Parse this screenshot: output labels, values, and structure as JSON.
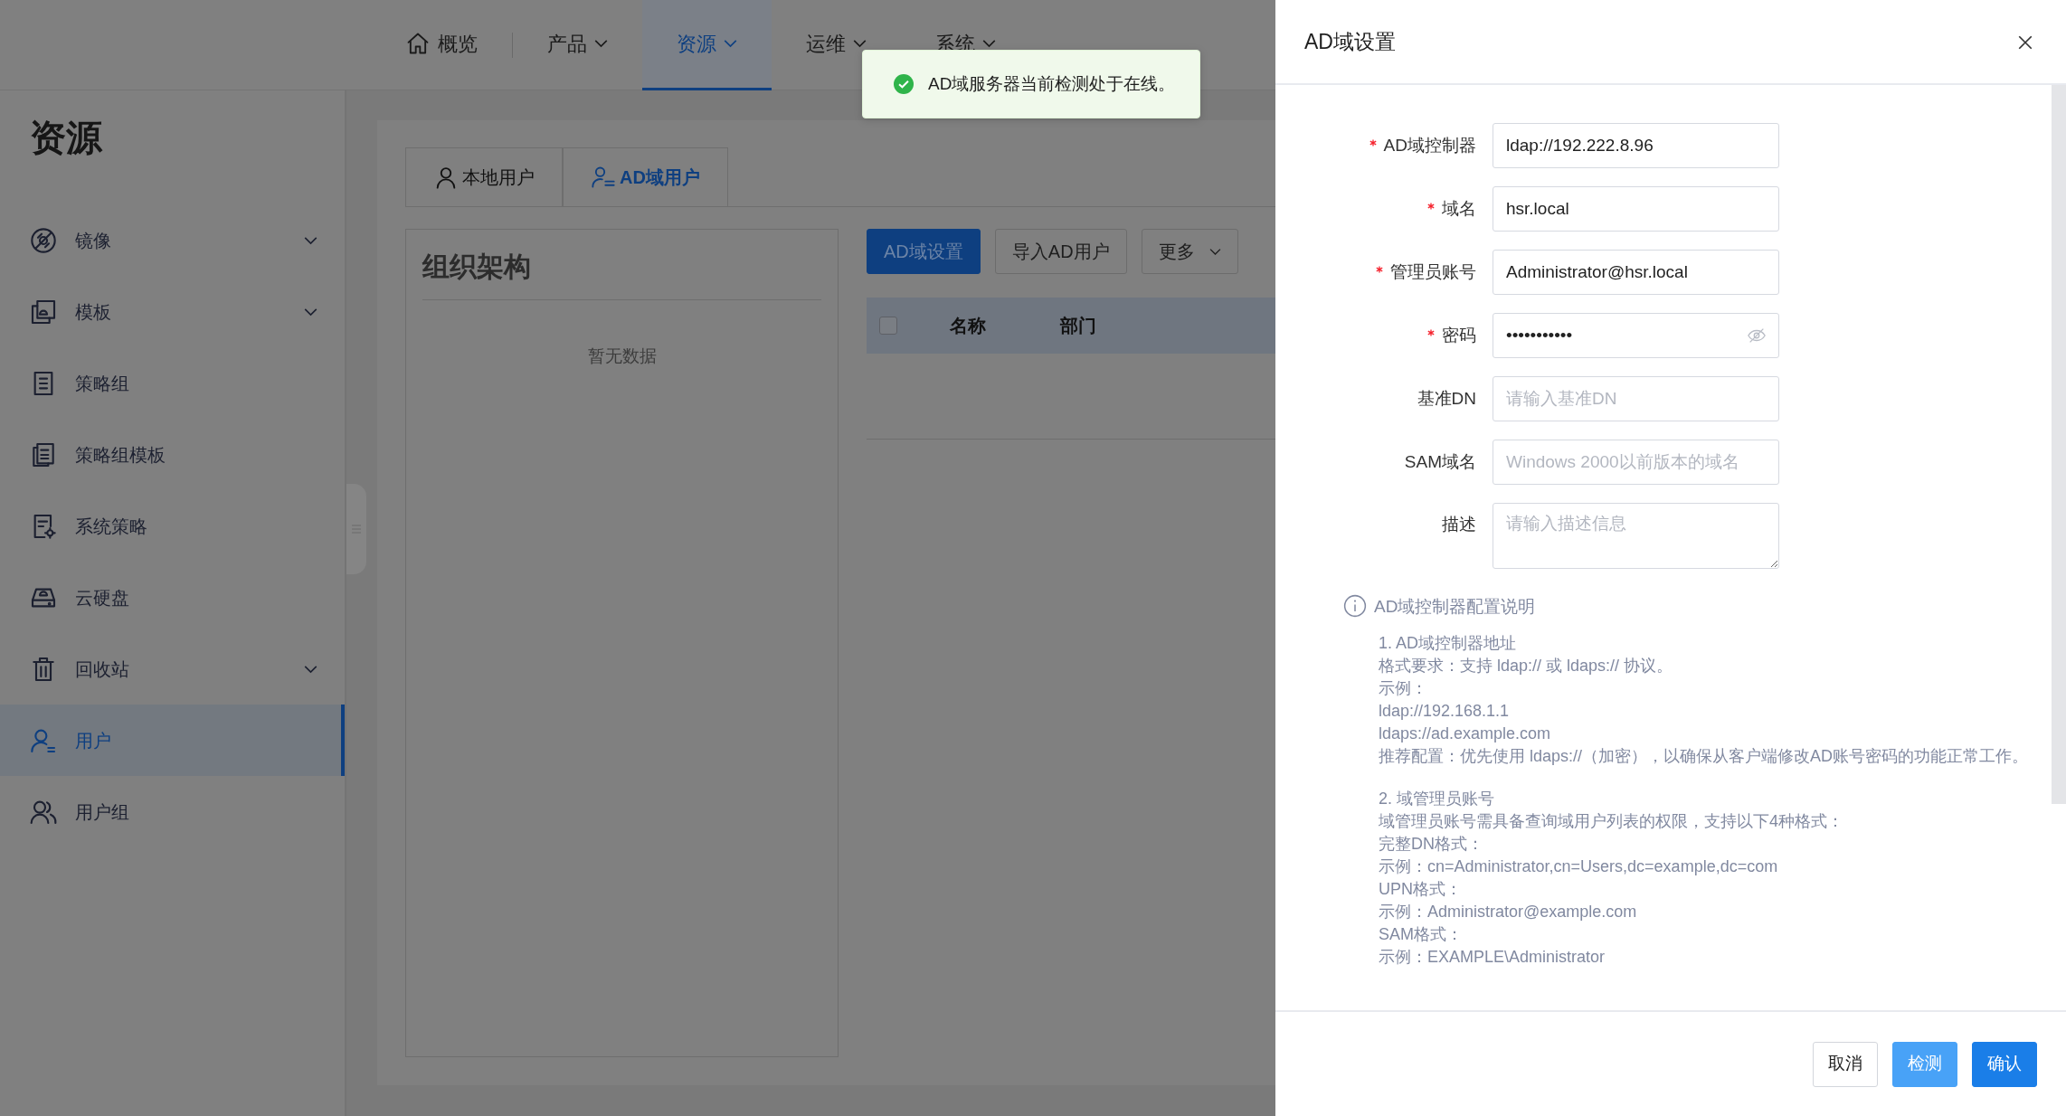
{
  "top_nav": {
    "items": [
      {
        "label": "概览",
        "kind": "home",
        "selected": false
      },
      {
        "label": "产品",
        "kind": "dropdown",
        "selected": false
      },
      {
        "label": "资源",
        "kind": "dropdown",
        "selected": true
      },
      {
        "label": "运维",
        "kind": "dropdown",
        "selected": false
      },
      {
        "label": "系统",
        "kind": "dropdown",
        "selected": false
      }
    ]
  },
  "toast": {
    "kind": "success",
    "message": "AD域服务器当前检测处于在线。"
  },
  "sidebar": {
    "title": "资源",
    "items": [
      {
        "label": "镜像",
        "expandable": true,
        "selected": false
      },
      {
        "label": "模板",
        "expandable": true,
        "selected": false
      },
      {
        "label": "策略组",
        "expandable": false,
        "selected": false
      },
      {
        "label": "策略组模板",
        "expandable": false,
        "selected": false
      },
      {
        "label": "系统策略",
        "expandable": false,
        "selected": false
      },
      {
        "label": "云硬盘",
        "expandable": false,
        "selected": false
      },
      {
        "label": "回收站",
        "expandable": true,
        "selected": false
      },
      {
        "label": "用户",
        "expandable": false,
        "selected": true
      },
      {
        "label": "用户组",
        "expandable": false,
        "selected": false
      }
    ]
  },
  "user_tabs": [
    {
      "label": "本地用户",
      "selected": false
    },
    {
      "label": "AD域用户",
      "selected": true
    }
  ],
  "org_panel": {
    "title": "组织架构",
    "empty_text": "暂无数据"
  },
  "toolbar": [
    {
      "label": "AD域设置",
      "kind": "primary"
    },
    {
      "label": "导入AD用户",
      "kind": "default"
    },
    {
      "label": "更多",
      "kind": "dropdown"
    }
  ],
  "table": {
    "select_all_checked": false,
    "columns": [
      "名称",
      "部门"
    ]
  },
  "drawer": {
    "title": "AD域设置",
    "fields": [
      {
        "label": "AD域控制器",
        "required": true,
        "kind": "text",
        "value": "ldap://192.222.8.96"
      },
      {
        "label": "域名",
        "required": true,
        "kind": "text",
        "value": "hsr.local"
      },
      {
        "label": "管理员账号",
        "required": true,
        "kind": "text",
        "value": "Administrator@hsr.local"
      },
      {
        "label": "密码",
        "required": true,
        "kind": "password",
        "value": "•••••••••••"
      },
      {
        "label": "基准DN",
        "required": false,
        "kind": "text",
        "placeholder": "请输入基准DN"
      },
      {
        "label": "SAM域名",
        "required": false,
        "kind": "text",
        "placeholder": "Windows 2000以前版本的域名"
      },
      {
        "label": "描述",
        "required": false,
        "kind": "textarea",
        "placeholder": "请输入描述信息"
      }
    ],
    "notes": {
      "title": "AD域控制器配置说明",
      "paragraphs": [
        [
          "1. AD域控制器地址",
          "格式要求：支持 ldap:// 或 ldaps:// 协议。",
          "示例：",
          "ldap://192.168.1.1",
          "ldaps://ad.example.com",
          "推荐配置：优先使用 ldaps://（加密），以确保从客户端修改AD账号密码的功能正常工作。"
        ],
        [
          "2. 域管理员账号",
          "域管理员账号需具备查询域用户列表的权限，支持以下4种格式：",
          "完整DN格式：",
          "示例：cn=Administrator,cn=Users,dc=example,dc=com",
          "UPN格式：",
          "示例：Administrator@example.com",
          "SAM格式：",
          "示例：EXAMPLE\\Administrator"
        ]
      ]
    },
    "buttons": [
      {
        "label": "取消",
        "kind": "default"
      },
      {
        "label": "检测",
        "kind": "light-primary"
      },
      {
        "label": "确认",
        "kind": "primary"
      }
    ]
  }
}
